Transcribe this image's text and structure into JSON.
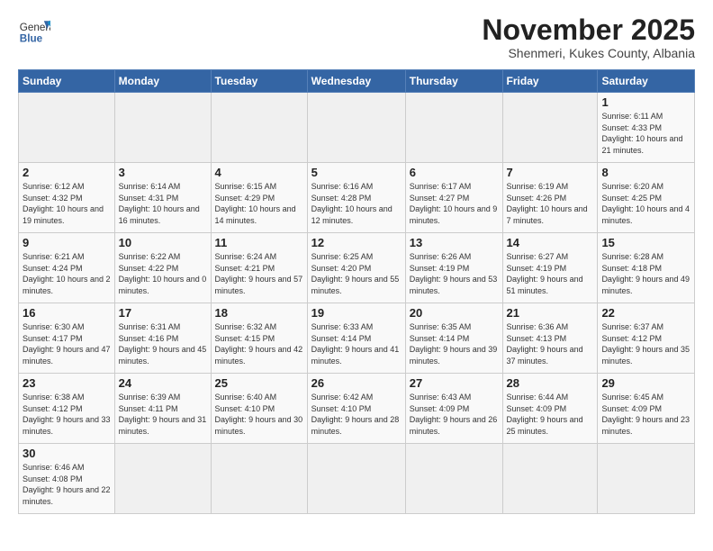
{
  "header": {
    "logo_general": "General",
    "logo_blue": "Blue",
    "month_title": "November 2025",
    "subtitle": "Shenmeri, Kukes County, Albania"
  },
  "days_of_week": [
    "Sunday",
    "Monday",
    "Tuesday",
    "Wednesday",
    "Thursday",
    "Friday",
    "Saturday"
  ],
  "weeks": [
    [
      {
        "day": "",
        "info": ""
      },
      {
        "day": "",
        "info": ""
      },
      {
        "day": "",
        "info": ""
      },
      {
        "day": "",
        "info": ""
      },
      {
        "day": "",
        "info": ""
      },
      {
        "day": "",
        "info": ""
      },
      {
        "day": "1",
        "info": "Sunrise: 6:11 AM\nSunset: 4:33 PM\nDaylight: 10 hours and 21 minutes."
      }
    ],
    [
      {
        "day": "2",
        "info": "Sunrise: 6:12 AM\nSunset: 4:32 PM\nDaylight: 10 hours and 19 minutes."
      },
      {
        "day": "3",
        "info": "Sunrise: 6:14 AM\nSunset: 4:31 PM\nDaylight: 10 hours and 16 minutes."
      },
      {
        "day": "4",
        "info": "Sunrise: 6:15 AM\nSunset: 4:29 PM\nDaylight: 10 hours and 14 minutes."
      },
      {
        "day": "5",
        "info": "Sunrise: 6:16 AM\nSunset: 4:28 PM\nDaylight: 10 hours and 12 minutes."
      },
      {
        "day": "6",
        "info": "Sunrise: 6:17 AM\nSunset: 4:27 PM\nDaylight: 10 hours and 9 minutes."
      },
      {
        "day": "7",
        "info": "Sunrise: 6:19 AM\nSunset: 4:26 PM\nDaylight: 10 hours and 7 minutes."
      },
      {
        "day": "8",
        "info": "Sunrise: 6:20 AM\nSunset: 4:25 PM\nDaylight: 10 hours and 4 minutes."
      }
    ],
    [
      {
        "day": "9",
        "info": "Sunrise: 6:21 AM\nSunset: 4:24 PM\nDaylight: 10 hours and 2 minutes."
      },
      {
        "day": "10",
        "info": "Sunrise: 6:22 AM\nSunset: 4:22 PM\nDaylight: 10 hours and 0 minutes."
      },
      {
        "day": "11",
        "info": "Sunrise: 6:24 AM\nSunset: 4:21 PM\nDaylight: 9 hours and 57 minutes."
      },
      {
        "day": "12",
        "info": "Sunrise: 6:25 AM\nSunset: 4:20 PM\nDaylight: 9 hours and 55 minutes."
      },
      {
        "day": "13",
        "info": "Sunrise: 6:26 AM\nSunset: 4:19 PM\nDaylight: 9 hours and 53 minutes."
      },
      {
        "day": "14",
        "info": "Sunrise: 6:27 AM\nSunset: 4:19 PM\nDaylight: 9 hours and 51 minutes."
      },
      {
        "day": "15",
        "info": "Sunrise: 6:28 AM\nSunset: 4:18 PM\nDaylight: 9 hours and 49 minutes."
      }
    ],
    [
      {
        "day": "16",
        "info": "Sunrise: 6:30 AM\nSunset: 4:17 PM\nDaylight: 9 hours and 47 minutes."
      },
      {
        "day": "17",
        "info": "Sunrise: 6:31 AM\nSunset: 4:16 PM\nDaylight: 9 hours and 45 minutes."
      },
      {
        "day": "18",
        "info": "Sunrise: 6:32 AM\nSunset: 4:15 PM\nDaylight: 9 hours and 42 minutes."
      },
      {
        "day": "19",
        "info": "Sunrise: 6:33 AM\nSunset: 4:14 PM\nDaylight: 9 hours and 41 minutes."
      },
      {
        "day": "20",
        "info": "Sunrise: 6:35 AM\nSunset: 4:14 PM\nDaylight: 9 hours and 39 minutes."
      },
      {
        "day": "21",
        "info": "Sunrise: 6:36 AM\nSunset: 4:13 PM\nDaylight: 9 hours and 37 minutes."
      },
      {
        "day": "22",
        "info": "Sunrise: 6:37 AM\nSunset: 4:12 PM\nDaylight: 9 hours and 35 minutes."
      }
    ],
    [
      {
        "day": "23",
        "info": "Sunrise: 6:38 AM\nSunset: 4:12 PM\nDaylight: 9 hours and 33 minutes."
      },
      {
        "day": "24",
        "info": "Sunrise: 6:39 AM\nSunset: 4:11 PM\nDaylight: 9 hours and 31 minutes."
      },
      {
        "day": "25",
        "info": "Sunrise: 6:40 AM\nSunset: 4:10 PM\nDaylight: 9 hours and 30 minutes."
      },
      {
        "day": "26",
        "info": "Sunrise: 6:42 AM\nSunset: 4:10 PM\nDaylight: 9 hours and 28 minutes."
      },
      {
        "day": "27",
        "info": "Sunrise: 6:43 AM\nSunset: 4:09 PM\nDaylight: 9 hours and 26 minutes."
      },
      {
        "day": "28",
        "info": "Sunrise: 6:44 AM\nSunset: 4:09 PM\nDaylight: 9 hours and 25 minutes."
      },
      {
        "day": "29",
        "info": "Sunrise: 6:45 AM\nSunset: 4:09 PM\nDaylight: 9 hours and 23 minutes."
      }
    ],
    [
      {
        "day": "30",
        "info": "Sunrise: 6:46 AM\nSunset: 4:08 PM\nDaylight: 9 hours and 22 minutes."
      },
      {
        "day": "",
        "info": ""
      },
      {
        "day": "",
        "info": ""
      },
      {
        "day": "",
        "info": ""
      },
      {
        "day": "",
        "info": ""
      },
      {
        "day": "",
        "info": ""
      },
      {
        "day": "",
        "info": ""
      }
    ]
  ]
}
